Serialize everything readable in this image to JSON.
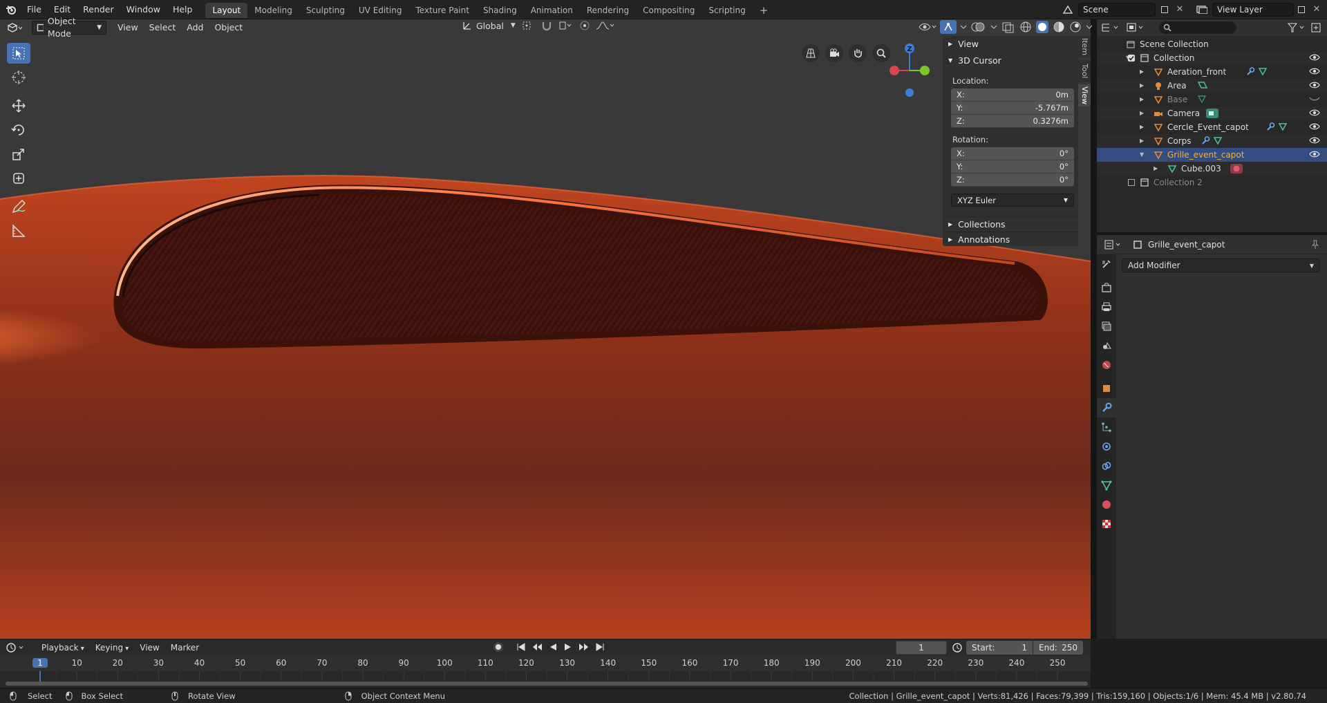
{
  "top_menu": [
    "File",
    "Edit",
    "Render",
    "Window",
    "Help"
  ],
  "workspace_tabs": [
    "Layout",
    "Modeling",
    "Sculpting",
    "UV Editing",
    "Texture Paint",
    "Shading",
    "Animation",
    "Rendering",
    "Compositing",
    "Scripting"
  ],
  "active_workspace": "Layout",
  "add_workspace": "+",
  "scene_name": "Scene",
  "view_layer_name": "View Layer",
  "viewport_header": {
    "mode": "Object Mode",
    "menus": [
      "View",
      "Select",
      "Add",
      "Object"
    ],
    "transform_orientation": "Global"
  },
  "gizmo": {
    "z_label": "Z"
  },
  "npanel": {
    "tabs": [
      "Item",
      "Tool",
      "View"
    ],
    "active_tab": "View",
    "view_header": "View",
    "cursor_header": "3D Cursor",
    "location_label": "Location:",
    "location": [
      {
        "axis": "X:",
        "value": "0m"
      },
      {
        "axis": "Y:",
        "value": "-5.767m"
      },
      {
        "axis": "Z:",
        "value": "0.3276m"
      }
    ],
    "rotation_label": "Rotation:",
    "rotation": [
      {
        "axis": "X:",
        "value": "0°"
      },
      {
        "axis": "Y:",
        "value": "0°"
      },
      {
        "axis": "Z:",
        "value": "0°"
      }
    ],
    "rotation_mode": "XYZ Euler",
    "collections_header": "Collections",
    "annotations_header": "Annotations"
  },
  "outliner": {
    "search_placeholder": "",
    "rows": [
      {
        "name": "Scene Collection",
        "indent": 0,
        "type": "scene"
      },
      {
        "name": "Collection",
        "indent": 1,
        "type": "collection",
        "eye": true
      },
      {
        "name": "Aeration_front",
        "indent": 2,
        "type": "mesh",
        "eye": true
      },
      {
        "name": "Area",
        "indent": 2,
        "type": "light",
        "eye": true
      },
      {
        "name": "Base",
        "indent": 2,
        "type": "mesh",
        "dim": true
      },
      {
        "name": "Camera",
        "indent": 2,
        "type": "camera",
        "eye": true
      },
      {
        "name": "Cercle_Event_capot",
        "indent": 2,
        "type": "mesh",
        "eye": true
      },
      {
        "name": "Corps",
        "indent": 2,
        "type": "mesh",
        "eye": true
      },
      {
        "name": "Grille_event_capot",
        "indent": 2,
        "type": "mesh",
        "eye": true,
        "selected": true
      },
      {
        "name": "Cube.003",
        "indent": 3,
        "type": "meshdata"
      },
      {
        "name": "Collection 2",
        "indent": 1,
        "type": "collection",
        "dim": true
      }
    ]
  },
  "properties": {
    "object_name": "Grille_event_capot",
    "add_modifier": "Add Modifier"
  },
  "timeline": {
    "menus": [
      "Playback",
      "Keying",
      "View",
      "Marker"
    ],
    "current_frame": "1",
    "start_label": "Start:",
    "start": "1",
    "end_label": "End:",
    "end": "250",
    "ticks": [
      "1",
      "10",
      "20",
      "30",
      "40",
      "50",
      "60",
      "70",
      "80",
      "90",
      "100",
      "110",
      "120",
      "130",
      "140",
      "150",
      "160",
      "170",
      "180",
      "190",
      "200",
      "210",
      "220",
      "230",
      "240",
      "250"
    ]
  },
  "statusbar": {
    "select": "Select",
    "box_select": "Box Select",
    "rotate_view": "Rotate View",
    "context_menu": "Object Context Menu",
    "stats": "Collection | Grille_event_capot | Verts:81,426 | Faces:79,399 | Tris:159,160 | Objects:1/6 | Mem: 45.4 MB | v2.80.74"
  },
  "colors": {
    "accent": "#4772b3",
    "selection": "#334d80",
    "car_paint": "#b8401f",
    "mesh_orange": "#e5893a",
    "mesh_data_green": "#4cc3a0"
  }
}
